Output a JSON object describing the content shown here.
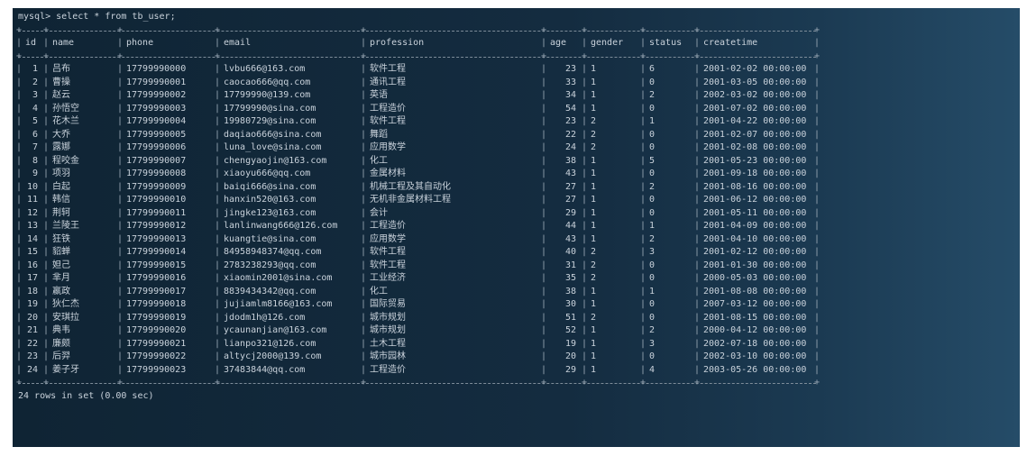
{
  "terminal": {
    "command": "mysql> select * from tb_user;",
    "footer": "24 rows in set (0.00 sec)"
  },
  "table": {
    "columns": [
      "id",
      "name",
      "phone",
      "email",
      "profession",
      "age",
      "gender",
      "status",
      "createtime"
    ],
    "rows": [
      [
        "1",
        "吕布",
        "17799990000",
        "lvbu666@163.com",
        "软件工程",
        "23",
        "1",
        "6",
        "2001-02-02 00:00:00"
      ],
      [
        "2",
        "曹操",
        "17799990001",
        "caocao666@qq.com",
        "通讯工程",
        "33",
        "1",
        "0",
        "2001-03-05 00:00:00"
      ],
      [
        "3",
        "赵云",
        "17799990002",
        "17799990@139.com",
        "英语",
        "34",
        "1",
        "2",
        "2002-03-02 00:00:00"
      ],
      [
        "4",
        "孙悟空",
        "17799990003",
        "17799990@sina.com",
        "工程造价",
        "54",
        "1",
        "0",
        "2001-07-02 00:00:00"
      ],
      [
        "5",
        "花木兰",
        "17799990004",
        "19980729@sina.com",
        "软件工程",
        "23",
        "2",
        "1",
        "2001-04-22 00:00:00"
      ],
      [
        "6",
        "大乔",
        "17799990005",
        "daqiao666@sina.com",
        "舞蹈",
        "22",
        "2",
        "0",
        "2001-02-07 00:00:00"
      ],
      [
        "7",
        "露娜",
        "17799990006",
        "luna_love@sina.com",
        "应用数学",
        "24",
        "2",
        "0",
        "2001-02-08 00:00:00"
      ],
      [
        "8",
        "程咬金",
        "17799990007",
        "chengyaojin@163.com",
        "化工",
        "38",
        "1",
        "5",
        "2001-05-23 00:00:00"
      ],
      [
        "9",
        "项羽",
        "17799990008",
        "xiaoyu666@qq.com",
        "金属材料",
        "43",
        "1",
        "0",
        "2001-09-18 00:00:00"
      ],
      [
        "10",
        "白起",
        "17799990009",
        "baiqi666@sina.com",
        "机械工程及其自动化",
        "27",
        "1",
        "2",
        "2001-08-16 00:00:00"
      ],
      [
        "11",
        "韩信",
        "17799990010",
        "hanxin520@163.com",
        "无机非金属材料工程",
        "27",
        "1",
        "0",
        "2001-06-12 00:00:00"
      ],
      [
        "12",
        "荆轲",
        "17799990011",
        "jingke123@163.com",
        "会计",
        "29",
        "1",
        "0",
        "2001-05-11 00:00:00"
      ],
      [
        "13",
        "兰陵王",
        "17799990012",
        "lanlinwang666@126.com",
        "工程造价",
        "44",
        "1",
        "1",
        "2001-04-09 00:00:00"
      ],
      [
        "14",
        "狂铁",
        "17799990013",
        "kuangtie@sina.com",
        "应用数学",
        "43",
        "1",
        "2",
        "2001-04-10 00:00:00"
      ],
      [
        "15",
        "貂蝉",
        "17799990014",
        "84958948374@qq.com",
        "软件工程",
        "40",
        "2",
        "3",
        "2001-02-12 00:00:00"
      ],
      [
        "16",
        "妲己",
        "17799990015",
        "2783238293@qq.com",
        "软件工程",
        "31",
        "2",
        "0",
        "2001-01-30 00:00:00"
      ],
      [
        "17",
        "芈月",
        "17799990016",
        "xiaomin2001@sina.com",
        "工业经济",
        "35",
        "2",
        "0",
        "2000-05-03 00:00:00"
      ],
      [
        "18",
        "嬴政",
        "17799990017",
        "8839434342@qq.com",
        "化工",
        "38",
        "1",
        "1",
        "2001-08-08 00:00:00"
      ],
      [
        "19",
        "狄仁杰",
        "17799990018",
        "jujiamlm8166@163.com",
        "国际贸易",
        "30",
        "1",
        "0",
        "2007-03-12 00:00:00"
      ],
      [
        "20",
        "安琪拉",
        "17799990019",
        "jdodm1h@126.com",
        "城市规划",
        "51",
        "2",
        "0",
        "2001-08-15 00:00:00"
      ],
      [
        "21",
        "典韦",
        "17799990020",
        "ycaunanjian@163.com",
        "城市规划",
        "52",
        "1",
        "2",
        "2000-04-12 00:00:00"
      ],
      [
        "22",
        "廉颇",
        "17799990021",
        "lianpo321@126.com",
        "土木工程",
        "19",
        "1",
        "3",
        "2002-07-18 00:00:00"
      ],
      [
        "23",
        "后羿",
        "17799990022",
        "altycj2000@139.com",
        "城市园林",
        "20",
        "1",
        "0",
        "2002-03-10 00:00:00"
      ],
      [
        "24",
        "姜子牙",
        "17799990023",
        "37483844@qq.com",
        "工程造价",
        "29",
        "1",
        "4",
        "2003-05-26 00:00:00"
      ]
    ]
  },
  "colors": {
    "background": "#142c40",
    "text": "#c9d2db",
    "border": "#9aa8b5"
  }
}
